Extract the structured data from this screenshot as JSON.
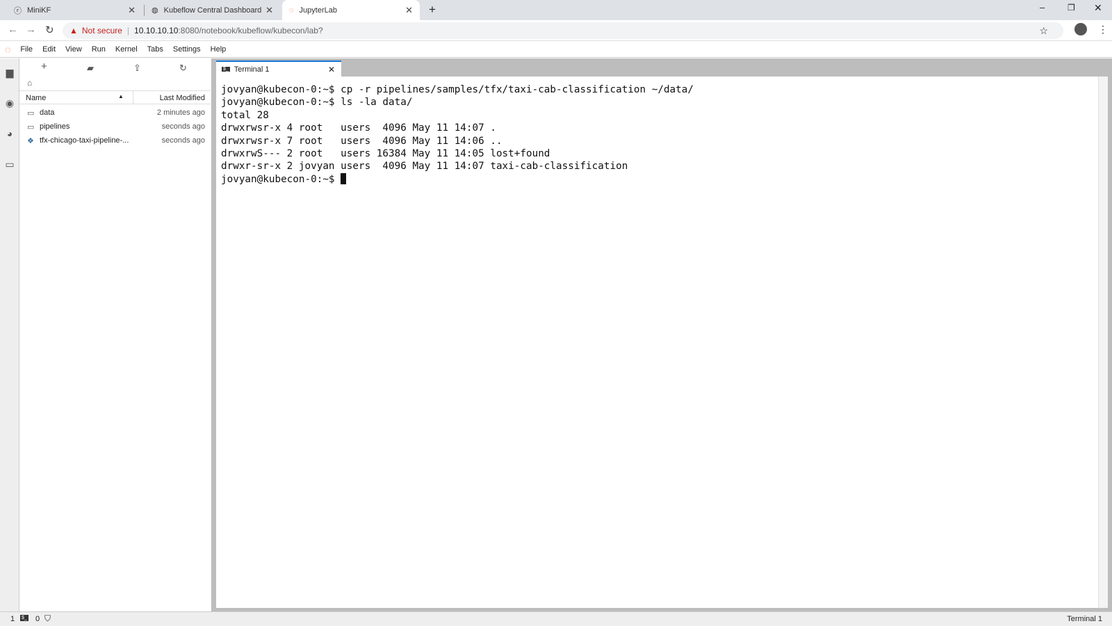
{
  "browser": {
    "tabs": [
      {
        "title": "MiniKF",
        "icon": "minikf-icon"
      },
      {
        "title": "Kubeflow Central Dashboard",
        "icon": "globe-icon"
      },
      {
        "title": "JupyterLab",
        "icon": "jupyter-icon",
        "active": true
      }
    ],
    "security_label": "Not secure",
    "url_host": "10.10.10.10",
    "url_rest": ":8080/notebook/kubeflow/kubecon/lab?"
  },
  "menu": [
    "File",
    "Edit",
    "View",
    "Run",
    "Kernel",
    "Tabs",
    "Settings",
    "Help"
  ],
  "filebrowser": {
    "col_name": "Name",
    "col_modified": "Last Modified",
    "items": [
      {
        "name": "data",
        "modified": "2 minutes ago",
        "type": "folder"
      },
      {
        "name": "pipelines",
        "modified": "seconds ago",
        "type": "folder"
      },
      {
        "name": "tfx-chicago-taxi-pipeline-...",
        "modified": "seconds ago",
        "type": "python"
      }
    ]
  },
  "terminal": {
    "tab_label": "Terminal 1",
    "lines": [
      "jovyan@kubecon-0:~$ cp -r pipelines/samples/tfx/taxi-cab-classification ~/data/",
      "jovyan@kubecon-0:~$ ls -la data/",
      "total 28",
      "drwxrwsr-x 4 root   users  4096 May 11 14:07 .",
      "drwxrwsr-x 7 root   users  4096 May 11 14:06 ..",
      "drwxrwS--- 2 root   users 16384 May 11 14:05 lost+found",
      "drwxr-sr-x 2 jovyan users  4096 May 11 14:07 taxi-cab-classification"
    ],
    "prompt": "jovyan@kubecon-0:~$ "
  },
  "status": {
    "terminals": "1",
    "kernels": "0",
    "right": "Terminal 1"
  }
}
